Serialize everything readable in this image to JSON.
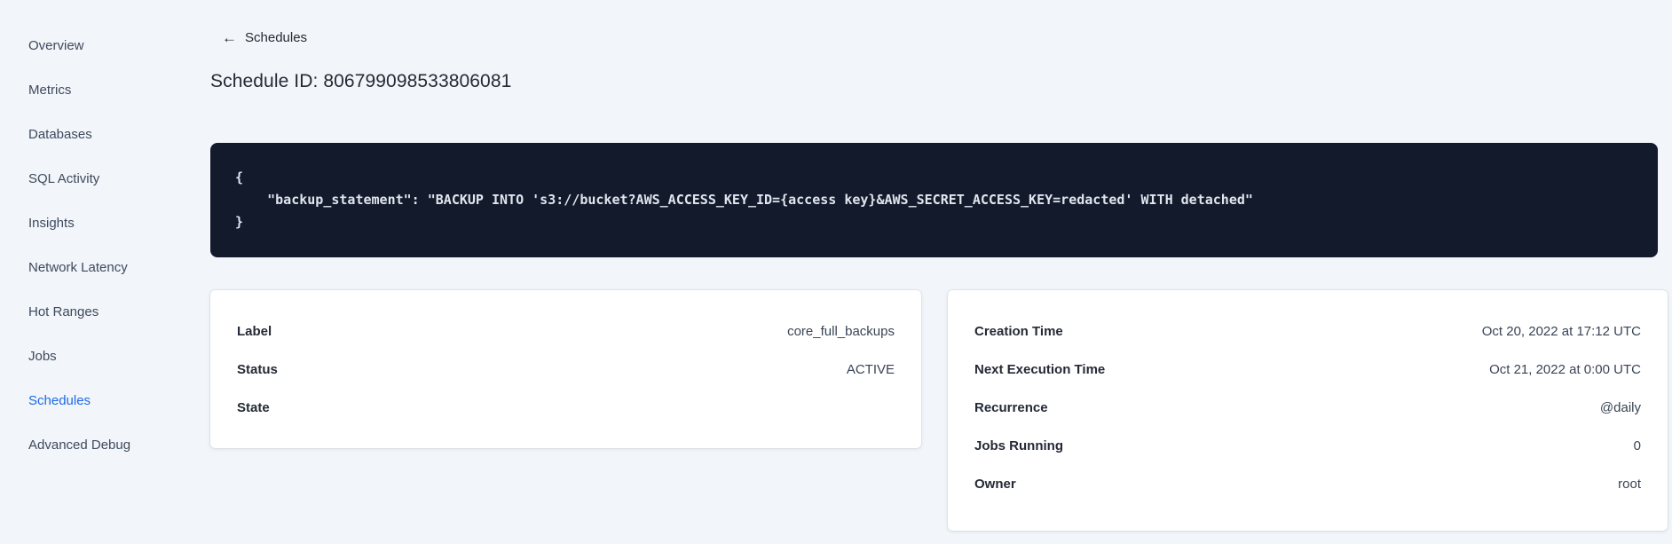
{
  "sidebar": {
    "items": [
      {
        "label": "Overview",
        "active": false
      },
      {
        "label": "Metrics",
        "active": false
      },
      {
        "label": "Databases",
        "active": false
      },
      {
        "label": "SQL Activity",
        "active": false
      },
      {
        "label": "Insights",
        "active": false
      },
      {
        "label": "Network Latency",
        "active": false
      },
      {
        "label": "Hot Ranges",
        "active": false
      },
      {
        "label": "Jobs",
        "active": false
      },
      {
        "label": "Schedules",
        "active": true
      },
      {
        "label": "Advanced Debug",
        "active": false
      }
    ]
  },
  "breadcrumb": {
    "back_icon": "left-arrow",
    "back_label": "Schedules"
  },
  "page": {
    "title": "Schedule ID: 806799098533806081"
  },
  "code_block": {
    "lines": [
      "{",
      "    \"backup_statement\": \"BACKUP INTO 's3://bucket?AWS_ACCESS_KEY_ID={access key}&AWS_SECRET_ACCESS_KEY=redacted' WITH detached\"",
      "}"
    ]
  },
  "summary_card": {
    "rows": [
      {
        "label": "Label",
        "value": "core_full_backups"
      },
      {
        "label": "Status",
        "value": "ACTIVE"
      },
      {
        "label": "State",
        "value": ""
      }
    ]
  },
  "schedule_card": {
    "rows": [
      {
        "label": "Creation Time",
        "value": "Oct 20, 2022 at 17:12 UTC"
      },
      {
        "label": "Next Execution Time",
        "value": "Oct 21, 2022 at 0:00 UTC"
      },
      {
        "label": "Recurrence",
        "value": "@daily"
      },
      {
        "label": "Jobs Running",
        "value": "0"
      },
      {
        "label": "Owner",
        "value": "root"
      }
    ]
  },
  "colors": {
    "accent_blue": "#1d6ae5",
    "page_background": "#f2f5f9",
    "code_background": "#121a2c",
    "code_text": "#e0e5ee",
    "heading_text": "#242a35",
    "body_text": "#394455"
  }
}
